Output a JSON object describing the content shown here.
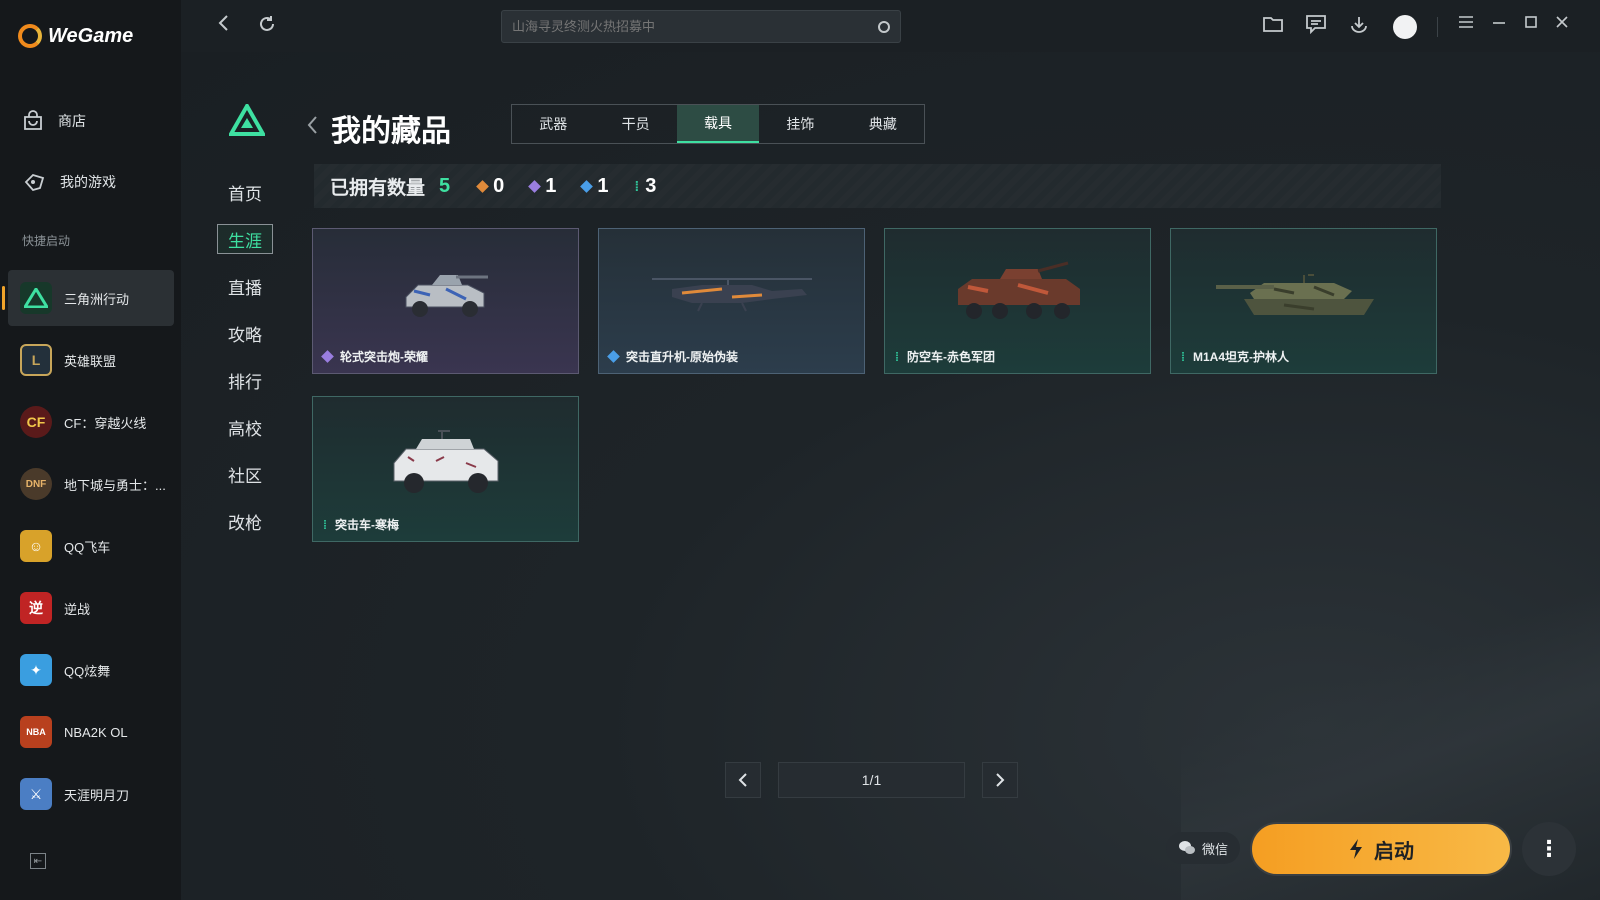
{
  "app": {
    "name": "WeGame"
  },
  "sidebar": {
    "store_label": "商店",
    "my_games_label": "我的游戏",
    "quick_launch_label": "快捷启动",
    "games": [
      {
        "label": "三角洲行动",
        "icon": "delta-force-icon",
        "color": "#1a3b2a"
      },
      {
        "label": "英雄联盟",
        "icon": "lol-icon",
        "color": "#23303b"
      },
      {
        "label": "CF：穿越火线",
        "icon": "cf-icon",
        "color": "#5a1a1a"
      },
      {
        "label": "地下城与勇士：...",
        "icon": "dnf-icon",
        "color": "#4a3a2a"
      },
      {
        "label": "QQ飞车",
        "icon": "qq-speed-icon",
        "color": "#d8a22a"
      },
      {
        "label": "逆战",
        "icon": "nizhan-icon",
        "color": "#c02424"
      },
      {
        "label": "QQ炫舞",
        "icon": "qq-dance-icon",
        "color": "#3a9ee0"
      },
      {
        "label": "NBA2K OL",
        "icon": "nba2k-icon",
        "color": "#b8401e"
      },
      {
        "label": "天涯明月刀",
        "icon": "tianya-icon",
        "color": "#4b7ec4"
      }
    ]
  },
  "topbar": {
    "search_placeholder": "山海寻灵终测火热招募中"
  },
  "main": {
    "title": "我的藏品",
    "tabs": [
      {
        "label": "武器",
        "active": false
      },
      {
        "label": "干员",
        "active": false
      },
      {
        "label": "载具",
        "active": true
      },
      {
        "label": "挂饰",
        "active": false
      },
      {
        "label": "典藏",
        "active": false
      }
    ],
    "subnav": [
      {
        "label": "首页",
        "active": false
      },
      {
        "label": "生涯",
        "active": true
      },
      {
        "label": "直播",
        "active": false
      },
      {
        "label": "攻略",
        "active": false
      },
      {
        "label": "排行",
        "active": false
      },
      {
        "label": "高校",
        "active": false
      },
      {
        "label": "社区",
        "active": false
      },
      {
        "label": "改枪",
        "active": false
      }
    ],
    "stats": {
      "label": "已拥有数量",
      "total": "5",
      "rarities": [
        {
          "count": "0",
          "color": "#e08a3a"
        },
        {
          "count": "1",
          "color": "#9a7ee0"
        },
        {
          "count": "1",
          "color": "#4a9ee8"
        },
        {
          "count": "3",
          "color": "#2fc79a"
        }
      ]
    },
    "items": [
      {
        "name": "轮式突击炮-荣耀",
        "rarity_color": "#9a7ee0",
        "style": "purple",
        "vehicle": "assault-gun"
      },
      {
        "name": "突击直升机-原始伪装",
        "rarity_color": "#4a9ee8",
        "style": "blue",
        "vehicle": "helicopter"
      },
      {
        "name": "防空车-赤色军团",
        "rarity_color": "#2fc79a",
        "style": "green",
        "vehicle": "aa-vehicle"
      },
      {
        "name": "M1A4坦克-护林人",
        "rarity_color": "#2fc79a",
        "style": "green",
        "vehicle": "tank"
      },
      {
        "name": "突击车-寒梅",
        "rarity_color": "#2fc79a",
        "style": "green",
        "vehicle": "assault-car"
      }
    ],
    "pagination": "1/1",
    "wechat_label": "微信",
    "launch_label": "启动"
  }
}
